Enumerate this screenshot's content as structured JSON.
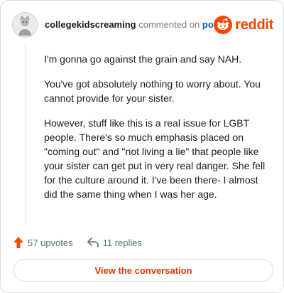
{
  "header": {
    "username": "collegekidscreaming",
    "action_text": "commented on",
    "post_link": "post",
    "brand": "reddit"
  },
  "comment": {
    "paragraphs": [
      "I'm gonna go against the grain and say NAH.",
      "You've got absolutely nothing to worry about. You cannot provide for your sister.",
      "However, stuff like this is a real issue for LGBT people. There's so much emphasis placed on \"coming out\" and \"not living a lie\" that people like your sister can get put in very real danger. She fell for the culture around it. I've been there- I almost did the same thing when I was her age."
    ]
  },
  "actions": {
    "upvotes": "57 upvotes",
    "replies": "11 replies"
  },
  "cta": {
    "label": "View the conversation"
  },
  "colors": {
    "brand": "#ff4500",
    "link": "#0a5fb4",
    "cta_text": "#d93a00",
    "upvote_arrow": "#ff4500"
  },
  "icons": [
    "avatar",
    "reddit-snoo-icon",
    "upvote-icon",
    "reply-icon"
  ]
}
